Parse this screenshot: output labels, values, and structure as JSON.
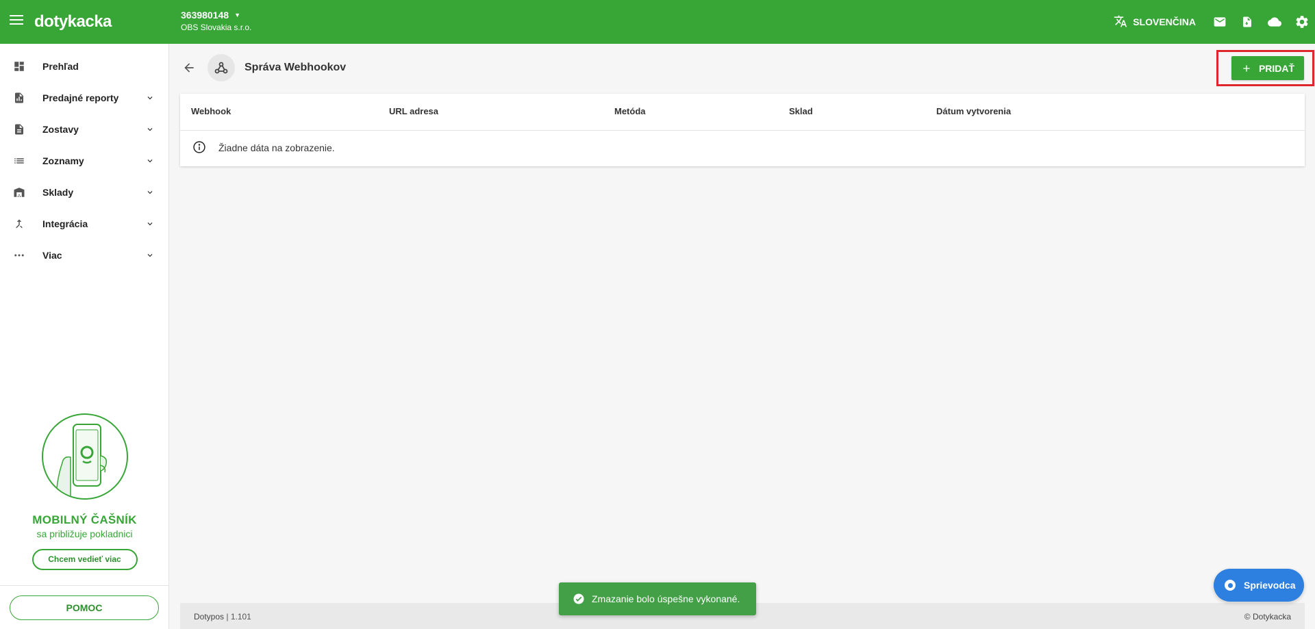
{
  "colors": {
    "brand": "#37a637",
    "highlight": "#e0262d",
    "guide": "#2d7fe0"
  },
  "topbar": {
    "logo": "dotykacka",
    "account_id": "363980148",
    "account_name": "OBS Slovakia s.r.o.",
    "language": "SLOVENČINA",
    "icons": [
      "translate-icon",
      "mail-icon",
      "document-icon",
      "cloud-icon",
      "gear-icon"
    ]
  },
  "sidebar": {
    "items": [
      {
        "label": "Prehľad",
        "icon": "dashboard-icon",
        "expandable": false
      },
      {
        "label": "Predajné reporty",
        "icon": "report-icon",
        "expandable": true
      },
      {
        "label": "Zostavy",
        "icon": "document-icon",
        "expandable": true
      },
      {
        "label": "Zoznamy",
        "icon": "list-icon",
        "expandable": true
      },
      {
        "label": "Sklady",
        "icon": "warehouse-icon",
        "expandable": true
      },
      {
        "label": "Integrácia",
        "icon": "merge-icon",
        "expandable": true
      },
      {
        "label": "Viac",
        "icon": "more-icon",
        "expandable": true
      }
    ],
    "promo": {
      "title": "MOBILNÝ ČAŠNÍK",
      "subtitle": "sa približuje pokladnici",
      "button": "Chcem vedieť viac"
    },
    "help": "POMOC"
  },
  "page": {
    "title": "Správa Webhookov",
    "add_button": "PRIDAŤ",
    "columns": [
      "Webhook",
      "URL adresa",
      "Metóda",
      "Sklad",
      "Dátum vytvorenia"
    ],
    "empty_message": "Žiadne dáta na zobrazenie."
  },
  "footer": {
    "app": "Dotypos",
    "version": "| 1.101",
    "copyright": "© Dotykacka"
  },
  "toast": {
    "message": "Zmazanie bolo úspešne vykonané."
  },
  "guide": {
    "label": "Sprievodca"
  }
}
